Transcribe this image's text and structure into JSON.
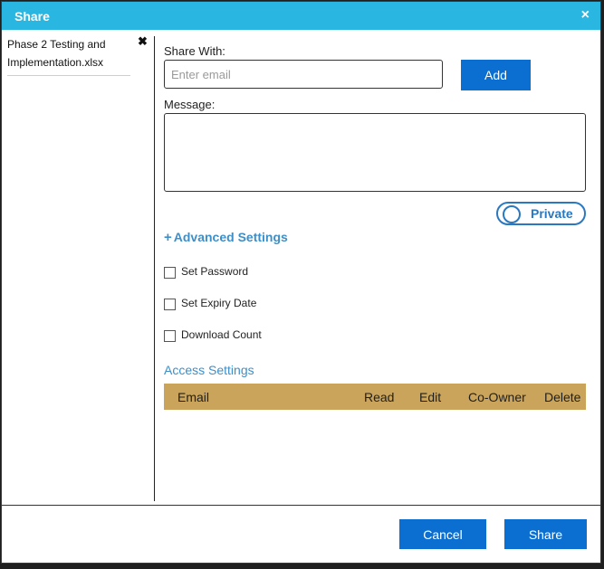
{
  "dialog": {
    "title": "Share",
    "close_icon": "×"
  },
  "sidebar": {
    "files": [
      {
        "name": "Phase 2 Testing and Implementation.xlsx",
        "remove_icon": "✖"
      }
    ]
  },
  "share_with": {
    "label": "Share With:",
    "email_placeholder": "Enter email",
    "email_value": "",
    "add_label": "Add"
  },
  "message": {
    "label": "Message:",
    "value": ""
  },
  "privacy_toggle": {
    "label": "Private"
  },
  "advanced_settings": {
    "toggle_icon": "+",
    "label": "Advanced Settings",
    "options": [
      {
        "label": "Set Password",
        "checked": false
      },
      {
        "label": "Set Expiry Date",
        "checked": false
      },
      {
        "label": "Download Count",
        "checked": false
      }
    ]
  },
  "access_settings": {
    "title": "Access Settings",
    "columns": [
      "Email",
      "Read",
      "Edit",
      "Co-Owner",
      "Delete"
    ],
    "rows": []
  },
  "footer": {
    "cancel_label": "Cancel",
    "share_label": "Share"
  },
  "colors": {
    "titlebar": "#29b6e0",
    "primary_button": "#0a6fd1",
    "link": "#3d8fc9",
    "table_header": "#c9a45a"
  }
}
